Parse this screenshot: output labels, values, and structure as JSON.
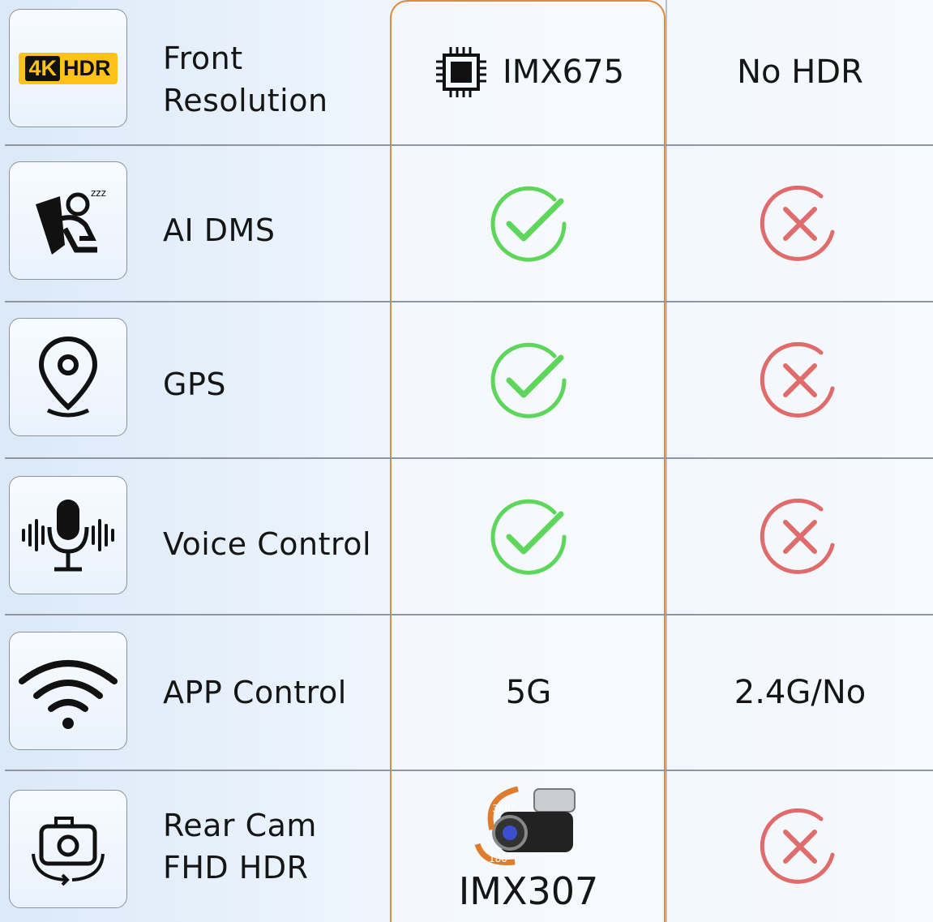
{
  "columns": {
    "highlight_color": "#e08a40"
  },
  "badge": {
    "k": "4K",
    "hdr": "HDR"
  },
  "rows": [
    {
      "label_lines": [
        "Front",
        "Resolution"
      ],
      "icon": "4k-hdr-badge-icon",
      "col2": "IMX675",
      "col2_icon": "chip-icon",
      "col3": "No HDR"
    },
    {
      "label_lines": [
        "AI DMS"
      ],
      "icon": "drowsy-driver-icon",
      "col2": "check",
      "col3": "cross"
    },
    {
      "label_lines": [
        "GPS"
      ],
      "icon": "location-pin-icon",
      "col2": "check",
      "col3": "cross"
    },
    {
      "label_lines": [
        "Voice Control"
      ],
      "icon": "microphone-icon",
      "col2": "check",
      "col3": "cross"
    },
    {
      "label_lines": [
        "APP Control"
      ],
      "icon": "wifi-icon",
      "col2": "5G",
      "col3": "2.4G/No"
    },
    {
      "label_lines": [
        "Rear Cam",
        "FHD HDR"
      ],
      "icon": "camera-rotate-icon",
      "col2": "IMX307",
      "col2_icon": "dash-camera-icon",
      "col2_badges": [
        "360°",
        "180°"
      ],
      "col3": "cross"
    }
  ],
  "colors": {
    "check": "#5dd65a",
    "cross": "#e06b6b"
  }
}
